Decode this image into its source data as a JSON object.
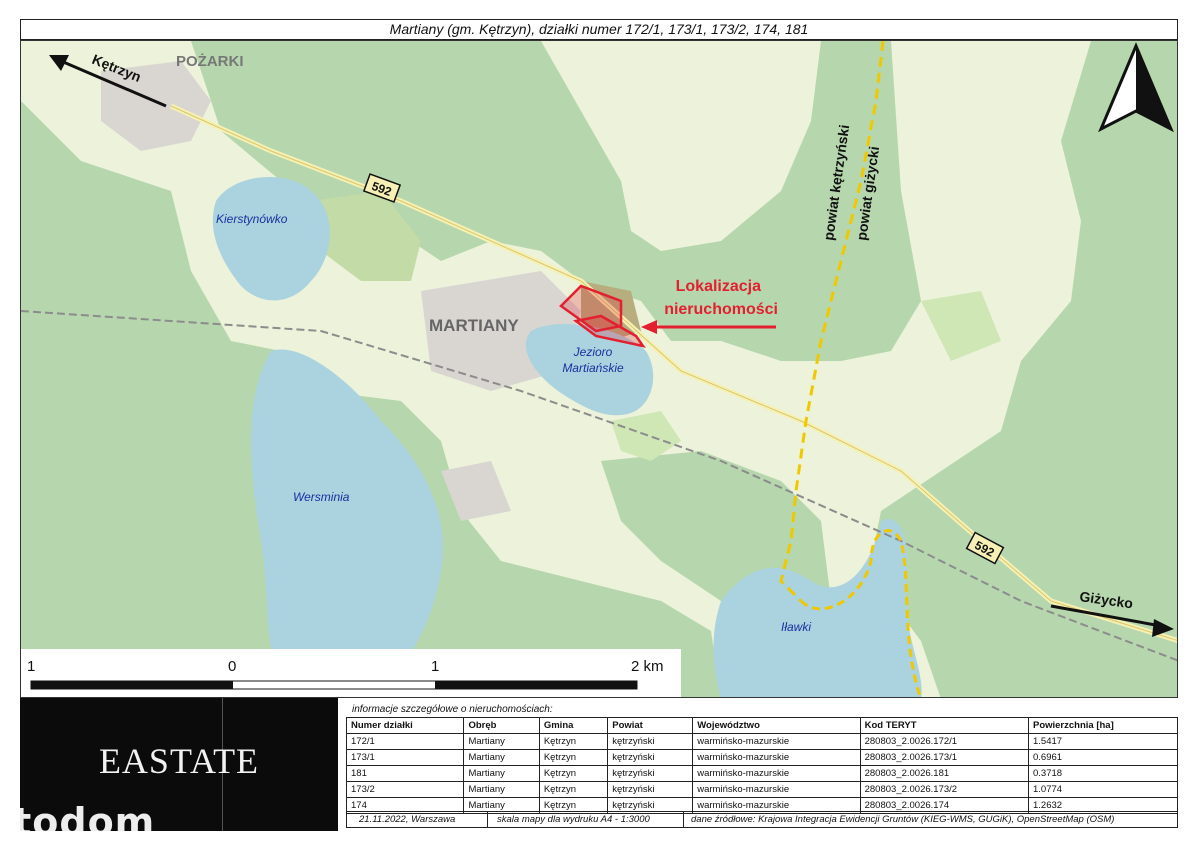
{
  "title": "Martiany (gm. Kętrzyn), działki numer 172/1, 173/1, 173/2, 174, 181",
  "map": {
    "places": {
      "pozarki": "POŻARKI",
      "martiany": "MARTIANY",
      "ketrzyn_arrow": "Kętrzyn",
      "gizycko_arrow": "Giżycko"
    },
    "lakes": {
      "kierstynowko": "Kierstynówko",
      "jezioro_line1": "Jezioro",
      "jezioro_line2": "Martiańskie",
      "wersminia": "Wersminia",
      "ilawki": "Iławki"
    },
    "road_number": "592",
    "powiat_ketrzynski": "powiat kętrzyński",
    "powiat_gizycki": "powiat giżycki",
    "location_label_line1": "Lokalizacja",
    "location_label_line2": "nieruchomości",
    "scale": {
      "labels": [
        "1",
        "0",
        "1",
        "2 km"
      ]
    },
    "colors": {
      "forest": "#b6d7ad",
      "farmland": "#edf2da",
      "meadow": "#cfe6b5",
      "water": "#aad3df",
      "urban": "#d9d6d2",
      "parcel": "#e3202f",
      "road": "#f6f0b4",
      "boundary": "#f0c800"
    }
  },
  "logo": {
    "brand": "EASTATE",
    "watermark": "otodom"
  },
  "info": {
    "caption": "informacje szczegółowe o nieruchomościach:",
    "headers": [
      "Numer działki",
      "Obręb",
      "Gmina",
      "Powiat",
      "Województwo",
      "Kod TERYT",
      "Powierzchnia [ha]"
    ],
    "rows": [
      [
        "172/1",
        "Martiany",
        "Kętrzyn",
        "kętrzyński",
        "warmińsko-mazurskie",
        "280803_2.0026.172/1",
        "1.5417"
      ],
      [
        "173/1",
        "Martiany",
        "Kętrzyn",
        "kętrzyński",
        "warmińsko-mazurskie",
        "280803_2.0026.173/1",
        "0.6961"
      ],
      [
        "181",
        "Martiany",
        "Kętrzyn",
        "kętrzyński",
        "warmińsko-mazurskie",
        "280803_2.0026.181",
        "0.3718"
      ],
      [
        "173/2",
        "Martiany",
        "Kętrzyn",
        "kętrzyński",
        "warmińsko-mazurskie",
        "280803_2.0026.173/2",
        "1.0774"
      ],
      [
        "174",
        "Martiany",
        "Kętrzyn",
        "kętrzyński",
        "warmińsko-mazurskie",
        "280803_2.0026.174",
        "1.2632"
      ]
    ]
  },
  "footer": {
    "date_place": "21.11.2022, Warszawa",
    "scale_note": "skala mapy dla wydruku A4 - 1:3000",
    "sources": "dane źródłowe: Krajowa Integracja Ewidencji Gruntów (KIEG-WMS, GUGiK), OpenStreetMap (OSM)"
  }
}
